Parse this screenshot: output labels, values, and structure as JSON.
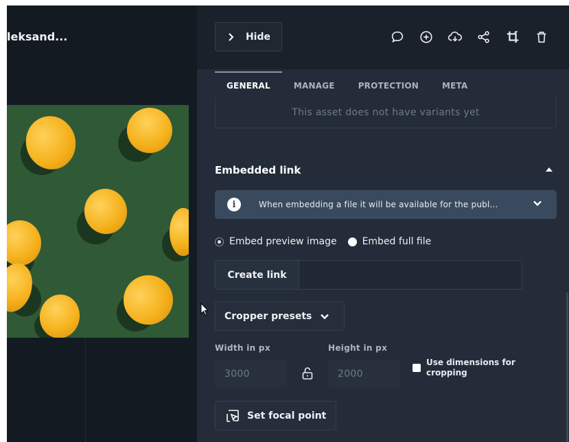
{
  "asset": {
    "title": "leksand..."
  },
  "toolbar": {
    "hide_label": "Hide",
    "icons": [
      "comment-icon",
      "add-circle-icon",
      "cloud-download-icon",
      "share-icon",
      "crop-icon",
      "trash-icon"
    ]
  },
  "tabs": [
    {
      "label": "GENERAL",
      "active": true
    },
    {
      "label": "MANAGE",
      "active": false
    },
    {
      "label": "PROTECTION",
      "active": false
    },
    {
      "label": "META",
      "active": false
    }
  ],
  "variants": {
    "empty_text": "This asset does not have variants yet"
  },
  "embedded_link": {
    "title": "Embedded link",
    "info_text": "When embedding a file it will be available for the publ...",
    "options": [
      {
        "label": "Embed preview image",
        "selected": true
      },
      {
        "label": "Embed full file",
        "selected": false
      }
    ],
    "create_link_label": "Create link",
    "link_value": ""
  },
  "cropper": {
    "presets_label": "Cropper presets",
    "width_label": "Width in px",
    "height_label": "Height in px",
    "width_value": "3000",
    "height_value": "2000",
    "use_dimensions_label": "Use dimensions for cropping",
    "use_dimensions_checked": false,
    "focal_point_label": "Set focal point"
  },
  "colors": {
    "background": "#141a22",
    "panel": "#232c38",
    "info_bar": "#3a4a5e",
    "preview_green": "#2f5a35",
    "lemon": "#f5b21d"
  }
}
